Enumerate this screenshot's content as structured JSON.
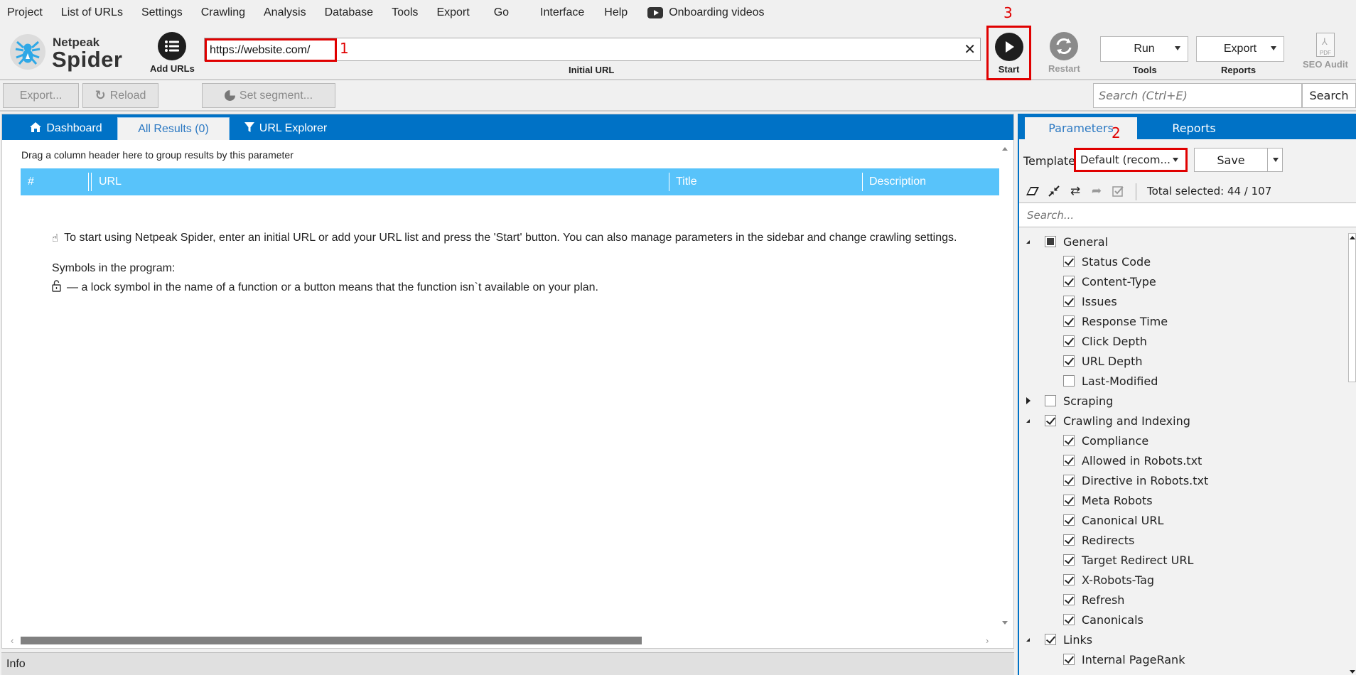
{
  "menu": [
    "Project",
    "List of URLs",
    "Settings",
    "Crawling",
    "Analysis",
    "Database",
    "Tools",
    "Export",
    "Go",
    "Interface",
    "Help"
  ],
  "onboarding": "Onboarding videos",
  "logo": {
    "line1": "Netpeak",
    "line2": "Spider"
  },
  "toolbar": {
    "add_urls": "Add URLs",
    "url_value": "https://website.com/",
    "url_label": "Initial URL",
    "clear": "✕",
    "start": "Start",
    "restart": "Restart",
    "run": "Run",
    "tools": "Tools",
    "export": "Export",
    "reports": "Reports",
    "seo_audit": "SEO Audit",
    "pdf": "PDF"
  },
  "annotations": {
    "a1": "1",
    "a2": "2",
    "a3": "3"
  },
  "toolbar2": {
    "export": "Export...",
    "reload": "Reload",
    "set_segment": "Set segment...",
    "search_placeholder": "Search (Ctrl+E)",
    "search_button": "Search"
  },
  "tabs": {
    "dashboard": "Dashboard",
    "all_results": "All Results (0)",
    "url_explorer": "URL Explorer"
  },
  "results": {
    "group_hint": "Drag a column header here to group results by this parameter",
    "columns": [
      "#",
      "URL",
      "Title",
      "Description"
    ],
    "intro": "To start using Netpeak Spider, enter an initial URL or add your URL list and press the 'Start' button. You can also manage parameters in the sidebar and change crawling settings.",
    "symbols_title": "Symbols in the program:",
    "lock_text": "— a lock symbol in the name of a function or a button means that the function isn`t available on your plan."
  },
  "info": "Info",
  "sidebar": {
    "tabs": {
      "parameters": "Parameters",
      "reports": "Reports"
    },
    "template_label": "Template:",
    "template_value": "Default (recom...",
    "save": "Save",
    "total_selected": "Total selected: 44 / 107",
    "search_placeholder": "Search...",
    "tree": [
      {
        "label": "General",
        "level": 0,
        "state": "partial",
        "expand": "open"
      },
      {
        "label": "Status Code",
        "level": 1,
        "state": "checked"
      },
      {
        "label": "Content-Type",
        "level": 1,
        "state": "checked"
      },
      {
        "label": "Issues",
        "level": 1,
        "state": "checked"
      },
      {
        "label": "Response Time",
        "level": 1,
        "state": "checked"
      },
      {
        "label": "Click Depth",
        "level": 1,
        "state": "checked"
      },
      {
        "label": "URL Depth",
        "level": 1,
        "state": "checked"
      },
      {
        "label": "Last-Modified",
        "level": 1,
        "state": "unchecked"
      },
      {
        "label": "Scraping",
        "level": 0,
        "state": "unchecked",
        "expand": "closed"
      },
      {
        "label": "Crawling and Indexing",
        "level": 0,
        "state": "checked",
        "expand": "open"
      },
      {
        "label": "Compliance",
        "level": 1,
        "state": "checked"
      },
      {
        "label": "Allowed in Robots.txt",
        "level": 1,
        "state": "checked"
      },
      {
        "label": "Directive in Robots.txt",
        "level": 1,
        "state": "checked"
      },
      {
        "label": "Meta Robots",
        "level": 1,
        "state": "checked"
      },
      {
        "label": "Canonical URL",
        "level": 1,
        "state": "checked"
      },
      {
        "label": "Redirects",
        "level": 1,
        "state": "checked"
      },
      {
        "label": "Target Redirect URL",
        "level": 1,
        "state": "checked"
      },
      {
        "label": "X-Robots-Tag",
        "level": 1,
        "state": "checked"
      },
      {
        "label": "Refresh",
        "level": 1,
        "state": "checked"
      },
      {
        "label": "Canonicals",
        "level": 1,
        "state": "checked"
      },
      {
        "label": "Links",
        "level": 0,
        "state": "checked",
        "expand": "open"
      },
      {
        "label": "Internal PageRank",
        "level": 1,
        "state": "checked"
      }
    ]
  },
  "colors": {
    "accent": "#0072c6",
    "header": "#58c3fa",
    "annotation": "#e00000",
    "logo": "#2fa8e6"
  }
}
